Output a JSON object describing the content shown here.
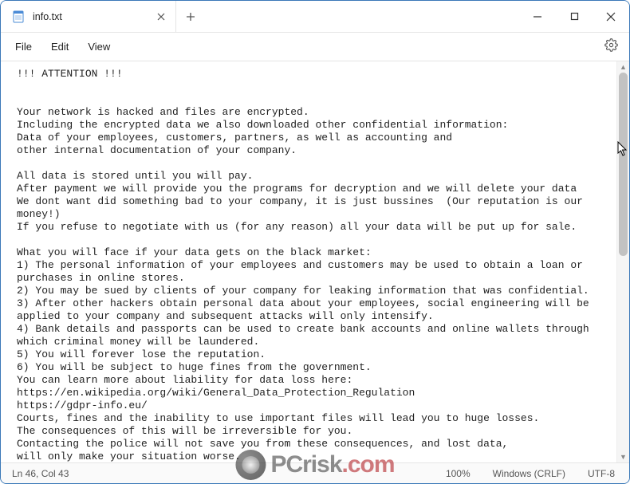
{
  "titlebar": {
    "tab_title": "info.txt",
    "doc_icon": "notepad-doc-icon"
  },
  "menubar": {
    "items": [
      "File",
      "Edit",
      "View"
    ]
  },
  "editor": {
    "text": "!!! ATTENTION !!!\n\n\nYour network is hacked and files are encrypted.\nIncluding the encrypted data we also downloaded other confidential information:\nData of your employees, customers, partners, as well as accounting and\nother internal documentation of your company.\n\nAll data is stored until you will pay.\nAfter payment we will provide you the programs for decryption and we will delete your data\nWe dont want did something bad to your company, it is just bussines  (Our reputation is our money!)\nIf you refuse to negotiate with us (for any reason) all your data will be put up for sale.\n\nWhat you will face if your data gets on the black market:\n1) The personal information of your employees and customers may be used to obtain a loan or\npurchases in online stores.\n2) You may be sued by clients of your company for leaking information that was confidential.\n3) After other hackers obtain personal data about your employees, social engineering will be\napplied to your company and subsequent attacks will only intensify.\n4) Bank details and passports can be used to create bank accounts and online wallets through\nwhich criminal money will be laundered.\n5) You will forever lose the reputation.\n6) You will be subject to huge fines from the government.\nYou can learn more about liability for data loss here:\nhttps://en.wikipedia.org/wiki/General_Data_Protection_Regulation\nhttps://gdpr-info.eu/\nCourts, fines and the inability to use important files will lead you to huge losses.\nThe consequences of this will be irreversible for you.\nContacting the police will not save you from these consequences, and lost data,\nwill only make your situation worse."
  },
  "statusbar": {
    "ln_col": "Ln 46, Col 43",
    "zoom": "100%",
    "line_ending": "Windows (CRLF)",
    "encoding": "UTF-8"
  },
  "watermark": {
    "part1": "PCrisk",
    "part2": ".com"
  }
}
